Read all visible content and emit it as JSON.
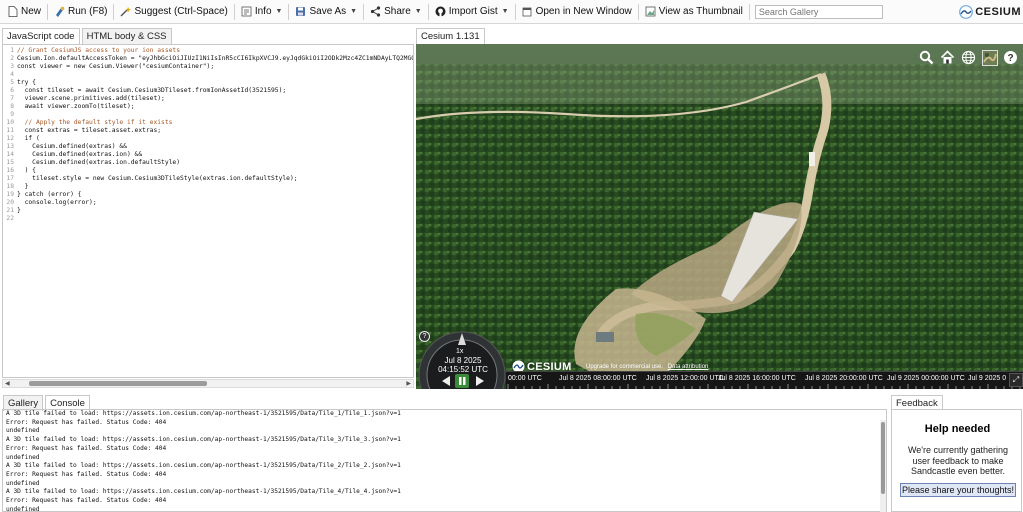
{
  "toolbar": {
    "new_label": "New",
    "run_label": "Run (F8)",
    "suggest_label": "Suggest (Ctrl-Space)",
    "info_label": "Info",
    "save_label": "Save As",
    "share_label": "Share",
    "import_label": "Import Gist",
    "open_window_label": "Open in New Window",
    "thumbnail_label": "View as Thumbnail",
    "search_placeholder": "Search Gallery",
    "brand": "CESIUM"
  },
  "code_panel": {
    "tabs": [
      "JavaScript code",
      "HTML body & CSS"
    ],
    "lines": [
      "// Grant CesiumJS access to your ion assets",
      "Cesium.Ion.defaultAccessToken = \"eyJhbGciOiJIUzI1NiIsInR5cCI6IkpXVCJ9.eyJqdGkiOiI2ODk2Mzc4ZC1mNDAyLTQ2MGQt",
      "const viewer = new Cesium.Viewer(\"cesiumContainer\");",
      "",
      "try {",
      "  const tileset = await Cesium.Cesium3DTileset.fromIonAssetId(3521595);",
      "  viewer.scene.primitives.add(tileset);",
      "  await viewer.zoomTo(tileset);",
      "",
      "  // Apply the default style if it exists",
      "  const extras = tileset.asset.extras;",
      "  if (",
      "    Cesium.defined(extras) &&",
      "    Cesium.defined(extras.ion) &&",
      "    Cesium.defined(extras.ion.defaultStyle)",
      "  ) {",
      "    tileset.style = new Cesium.Cesium3DTileStyle(extras.ion.defaultStyle);",
      "  }",
      "} catch (error) {",
      "  console.log(error);",
      "}",
      ""
    ]
  },
  "viewer": {
    "tab_label": "Cesium 1.131",
    "speed": "1x",
    "date": "Jul 8 2025",
    "time": "04:15:52 UTC",
    "credit_brand": "CESIUM",
    "credit_upgrade": "Upgrade for commercial use.",
    "credit_attribution": "Data attribution",
    "timeline_labels": [
      "00:00 UTC",
      "Jul 8 2025 08:00:00 UTC",
      "Jul 8 2025 12:00:00 UTC",
      "Jul 8 2025 16:00:00 UTC",
      "Jul 8 2025 20:00:00 UTC",
      "Jul 9 2025 00:00:00 UTC",
      "Jul 9 2025 0"
    ],
    "icons": [
      "search-icon",
      "home-icon",
      "globe-icon",
      "layers-icon",
      "help-icon"
    ]
  },
  "console": {
    "tabs": [
      "Gallery",
      "Console"
    ],
    "lines": [
      "A 3D tile failed to load: https://assets.ion.cesium.com/ap-northeast-1/3521595/Data/Tile_1/Tile_1.json?v=1",
      "Error: Request has failed. Status Code: 404",
      "undefined",
      "A 3D tile failed to load: https://assets.ion.cesium.com/ap-northeast-1/3521595/Data/Tile_3/Tile_3.json?v=1",
      "Error: Request has failed. Status Code: 404",
      "undefined",
      "A 3D tile failed to load: https://assets.ion.cesium.com/ap-northeast-1/3521595/Data/Tile_2/Tile_2.json?v=1",
      "Error: Request has failed. Status Code: 404",
      "undefined",
      "A 3D tile failed to load: https://assets.ion.cesium.com/ap-northeast-1/3521595/Data/Tile_4/Tile_4.json?v=1",
      "Error: Request has failed. Status Code: 404",
      "undefined",
      "A 3D tile failed to load: https://assets.ion.cesium.com/ap-northeast-1/3521595/Data/Tile_5/Tile_5.json?v=1",
      "Error: Request has failed. Status Code: 404"
    ]
  },
  "feedback": {
    "tab_label": "Feedback",
    "title": "Help needed",
    "text": "We're currently gathering user feedback to make Sandcastle even better.",
    "button_label": "Please share your thoughts!"
  }
}
